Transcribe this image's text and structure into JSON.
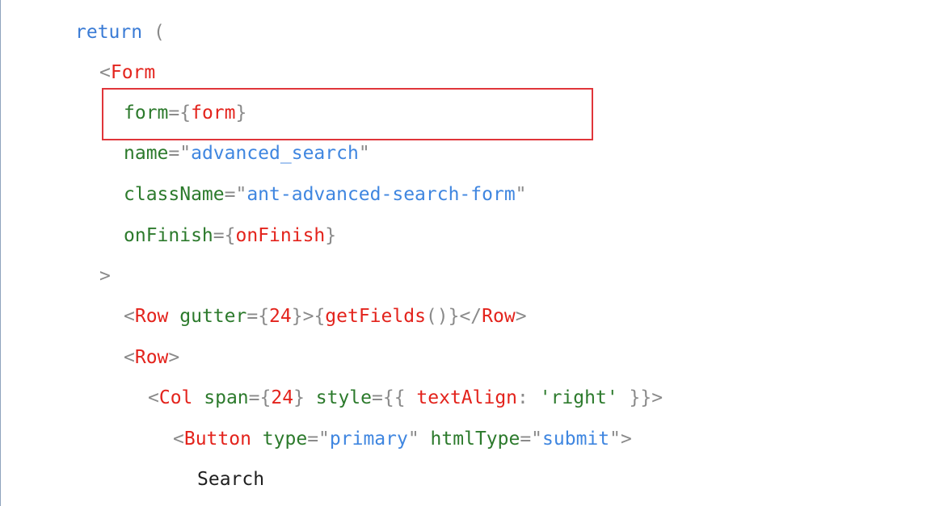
{
  "colors": {
    "keyword": "#3a7bd5",
    "tag": "#e3231c",
    "attribute": "#2c7a2c",
    "string": "#3f86e0",
    "punctuation": "#8a8a8a",
    "text": "#1f1f1f",
    "highlight_border": "#e0353a"
  },
  "code_lines": [
    {
      "tokens": [
        {
          "t": "kw",
          "v": "return"
        },
        {
          "t": "punc",
          "v": " ("
        }
      ]
    },
    {
      "tokens": [
        {
          "t": "punc",
          "v": "<"
        },
        {
          "t": "tag",
          "v": "Form"
        }
      ]
    },
    {
      "tokens": [
        {
          "t": "attr",
          "v": "form"
        },
        {
          "t": "punc",
          "v": "={"
        },
        {
          "t": "tag",
          "v": "form"
        },
        {
          "t": "punc",
          "v": "}"
        }
      ]
    },
    {
      "tokens": [
        {
          "t": "attr",
          "v": "name"
        },
        {
          "t": "punc",
          "v": "=\""
        },
        {
          "t": "str",
          "v": "advanced_search"
        },
        {
          "t": "punc",
          "v": "\""
        }
      ]
    },
    {
      "tokens": [
        {
          "t": "attr",
          "v": "className"
        },
        {
          "t": "punc",
          "v": "=\""
        },
        {
          "t": "str",
          "v": "ant-advanced-search-form"
        },
        {
          "t": "punc",
          "v": "\""
        }
      ]
    },
    {
      "tokens": [
        {
          "t": "attr",
          "v": "onFinish"
        },
        {
          "t": "punc",
          "v": "={"
        },
        {
          "t": "tag",
          "v": "onFinish"
        },
        {
          "t": "punc",
          "v": "}"
        }
      ]
    },
    {
      "tokens": [
        {
          "t": "punc",
          "v": ">"
        }
      ]
    },
    {
      "tokens": [
        {
          "t": "punc",
          "v": "<"
        },
        {
          "t": "tag",
          "v": "Row"
        },
        {
          "t": "attr",
          "v": " gutter"
        },
        {
          "t": "punc",
          "v": "={"
        },
        {
          "t": "tag",
          "v": "24"
        },
        {
          "t": "punc",
          "v": "}>{"
        },
        {
          "t": "tag",
          "v": "getFields"
        },
        {
          "t": "punc",
          "v": "()}</"
        },
        {
          "t": "tag",
          "v": "Row"
        },
        {
          "t": "punc",
          "v": ">"
        }
      ]
    },
    {
      "tokens": [
        {
          "t": "punc",
          "v": "<"
        },
        {
          "t": "tag",
          "v": "Row"
        },
        {
          "t": "punc",
          "v": ">"
        }
      ]
    },
    {
      "tokens": [
        {
          "t": "punc",
          "v": "<"
        },
        {
          "t": "tag",
          "v": "Col"
        },
        {
          "t": "attr",
          "v": " span"
        },
        {
          "t": "punc",
          "v": "={"
        },
        {
          "t": "tag",
          "v": "24"
        },
        {
          "t": "punc",
          "v": "}"
        },
        {
          "t": "attr",
          "v": " style"
        },
        {
          "t": "punc",
          "v": "={{ "
        },
        {
          "t": "tag",
          "v": "textAlign"
        },
        {
          "t": "punc",
          "v": ": "
        },
        {
          "t": "attr",
          "v": "'right'"
        },
        {
          "t": "punc",
          "v": " }}>"
        }
      ]
    },
    {
      "tokens": [
        {
          "t": "punc",
          "v": "<"
        },
        {
          "t": "tag",
          "v": "Button"
        },
        {
          "t": "attr",
          "v": " type"
        },
        {
          "t": "punc",
          "v": "=\""
        },
        {
          "t": "str",
          "v": "primary"
        },
        {
          "t": "punc",
          "v": "\""
        },
        {
          "t": "attr",
          "v": " htmlType"
        },
        {
          "t": "punc",
          "v": "=\""
        },
        {
          "t": "str",
          "v": "submit"
        },
        {
          "t": "punc",
          "v": "\">"
        }
      ]
    },
    {
      "tokens": [
        {
          "t": "text",
          "v": "Search"
        }
      ]
    }
  ],
  "highlighted_line": "form={form}"
}
